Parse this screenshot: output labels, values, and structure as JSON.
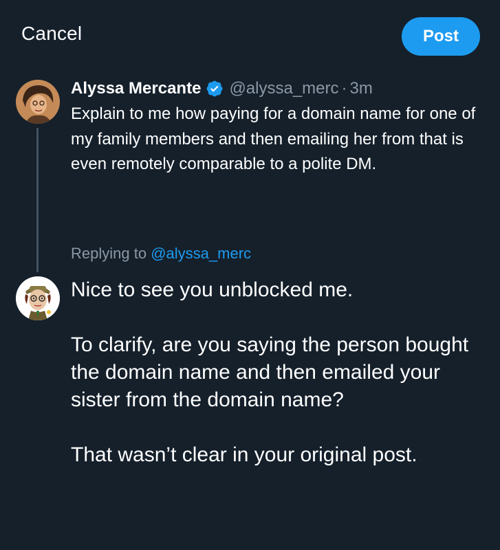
{
  "header": {
    "cancel_label": "Cancel",
    "post_label": "Post"
  },
  "original_post": {
    "display_name": "Alyssa Mercante",
    "verified": true,
    "handle": "@alyssa_merc",
    "separator": "·",
    "time": "3m",
    "text": "Explain to me how paying for a domain name for one of my family members and then emailing her from that is even remotely comparable to a polite DM."
  },
  "reply": {
    "replying_prefix": "Replying to",
    "replying_handle": "@alyssa_merc",
    "text": "Nice to see you unblocked me.\n\nTo clarify, are you saying the person bought the domain name and then emailed your sister from the domain name?\n\nThat wasn’t clear in your original post."
  },
  "colors": {
    "background": "#15202b",
    "accent": "#1d9bf0",
    "secondary_text": "#8b98a5",
    "thread_line": "#425364"
  },
  "icons": {
    "verified": "verified-badge-icon"
  }
}
